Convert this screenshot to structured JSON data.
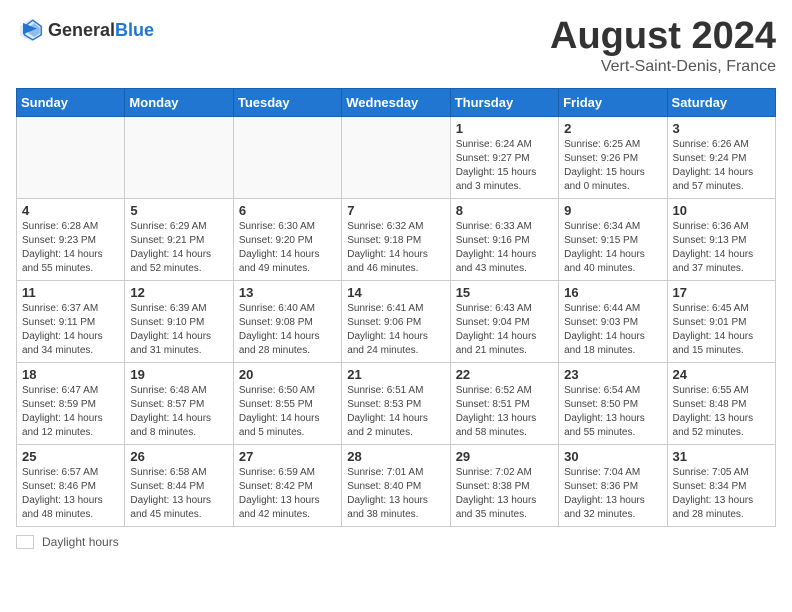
{
  "header": {
    "logo_general": "General",
    "logo_blue": "Blue",
    "month_year": "August 2024",
    "location": "Vert-Saint-Denis, France"
  },
  "footer": {
    "daylight_label": "Daylight hours"
  },
  "days_of_week": [
    "Sunday",
    "Monday",
    "Tuesday",
    "Wednesday",
    "Thursday",
    "Friday",
    "Saturday"
  ],
  "weeks": [
    [
      {
        "day": "",
        "info": ""
      },
      {
        "day": "",
        "info": ""
      },
      {
        "day": "",
        "info": ""
      },
      {
        "day": "",
        "info": ""
      },
      {
        "day": "1",
        "info": "Sunrise: 6:24 AM\nSunset: 9:27 PM\nDaylight: 15 hours\nand 3 minutes."
      },
      {
        "day": "2",
        "info": "Sunrise: 6:25 AM\nSunset: 9:26 PM\nDaylight: 15 hours\nand 0 minutes."
      },
      {
        "day": "3",
        "info": "Sunrise: 6:26 AM\nSunset: 9:24 PM\nDaylight: 14 hours\nand 57 minutes."
      }
    ],
    [
      {
        "day": "4",
        "info": "Sunrise: 6:28 AM\nSunset: 9:23 PM\nDaylight: 14 hours\nand 55 minutes."
      },
      {
        "day": "5",
        "info": "Sunrise: 6:29 AM\nSunset: 9:21 PM\nDaylight: 14 hours\nand 52 minutes."
      },
      {
        "day": "6",
        "info": "Sunrise: 6:30 AM\nSunset: 9:20 PM\nDaylight: 14 hours\nand 49 minutes."
      },
      {
        "day": "7",
        "info": "Sunrise: 6:32 AM\nSunset: 9:18 PM\nDaylight: 14 hours\nand 46 minutes."
      },
      {
        "day": "8",
        "info": "Sunrise: 6:33 AM\nSunset: 9:16 PM\nDaylight: 14 hours\nand 43 minutes."
      },
      {
        "day": "9",
        "info": "Sunrise: 6:34 AM\nSunset: 9:15 PM\nDaylight: 14 hours\nand 40 minutes."
      },
      {
        "day": "10",
        "info": "Sunrise: 6:36 AM\nSunset: 9:13 PM\nDaylight: 14 hours\nand 37 minutes."
      }
    ],
    [
      {
        "day": "11",
        "info": "Sunrise: 6:37 AM\nSunset: 9:11 PM\nDaylight: 14 hours\nand 34 minutes."
      },
      {
        "day": "12",
        "info": "Sunrise: 6:39 AM\nSunset: 9:10 PM\nDaylight: 14 hours\nand 31 minutes."
      },
      {
        "day": "13",
        "info": "Sunrise: 6:40 AM\nSunset: 9:08 PM\nDaylight: 14 hours\nand 28 minutes."
      },
      {
        "day": "14",
        "info": "Sunrise: 6:41 AM\nSunset: 9:06 PM\nDaylight: 14 hours\nand 24 minutes."
      },
      {
        "day": "15",
        "info": "Sunrise: 6:43 AM\nSunset: 9:04 PM\nDaylight: 14 hours\nand 21 minutes."
      },
      {
        "day": "16",
        "info": "Sunrise: 6:44 AM\nSunset: 9:03 PM\nDaylight: 14 hours\nand 18 minutes."
      },
      {
        "day": "17",
        "info": "Sunrise: 6:45 AM\nSunset: 9:01 PM\nDaylight: 14 hours\nand 15 minutes."
      }
    ],
    [
      {
        "day": "18",
        "info": "Sunrise: 6:47 AM\nSunset: 8:59 PM\nDaylight: 14 hours\nand 12 minutes."
      },
      {
        "day": "19",
        "info": "Sunrise: 6:48 AM\nSunset: 8:57 PM\nDaylight: 14 hours\nand 8 minutes."
      },
      {
        "day": "20",
        "info": "Sunrise: 6:50 AM\nSunset: 8:55 PM\nDaylight: 14 hours\nand 5 minutes."
      },
      {
        "day": "21",
        "info": "Sunrise: 6:51 AM\nSunset: 8:53 PM\nDaylight: 14 hours\nand 2 minutes."
      },
      {
        "day": "22",
        "info": "Sunrise: 6:52 AM\nSunset: 8:51 PM\nDaylight: 13 hours\nand 58 minutes."
      },
      {
        "day": "23",
        "info": "Sunrise: 6:54 AM\nSunset: 8:50 PM\nDaylight: 13 hours\nand 55 minutes."
      },
      {
        "day": "24",
        "info": "Sunrise: 6:55 AM\nSunset: 8:48 PM\nDaylight: 13 hours\nand 52 minutes."
      }
    ],
    [
      {
        "day": "25",
        "info": "Sunrise: 6:57 AM\nSunset: 8:46 PM\nDaylight: 13 hours\nand 48 minutes."
      },
      {
        "day": "26",
        "info": "Sunrise: 6:58 AM\nSunset: 8:44 PM\nDaylight: 13 hours\nand 45 minutes."
      },
      {
        "day": "27",
        "info": "Sunrise: 6:59 AM\nSunset: 8:42 PM\nDaylight: 13 hours\nand 42 minutes."
      },
      {
        "day": "28",
        "info": "Sunrise: 7:01 AM\nSunset: 8:40 PM\nDaylight: 13 hours\nand 38 minutes."
      },
      {
        "day": "29",
        "info": "Sunrise: 7:02 AM\nSunset: 8:38 PM\nDaylight: 13 hours\nand 35 minutes."
      },
      {
        "day": "30",
        "info": "Sunrise: 7:04 AM\nSunset: 8:36 PM\nDaylight: 13 hours\nand 32 minutes."
      },
      {
        "day": "31",
        "info": "Sunrise: 7:05 AM\nSunset: 8:34 PM\nDaylight: 13 hours\nand 28 minutes."
      }
    ]
  ]
}
